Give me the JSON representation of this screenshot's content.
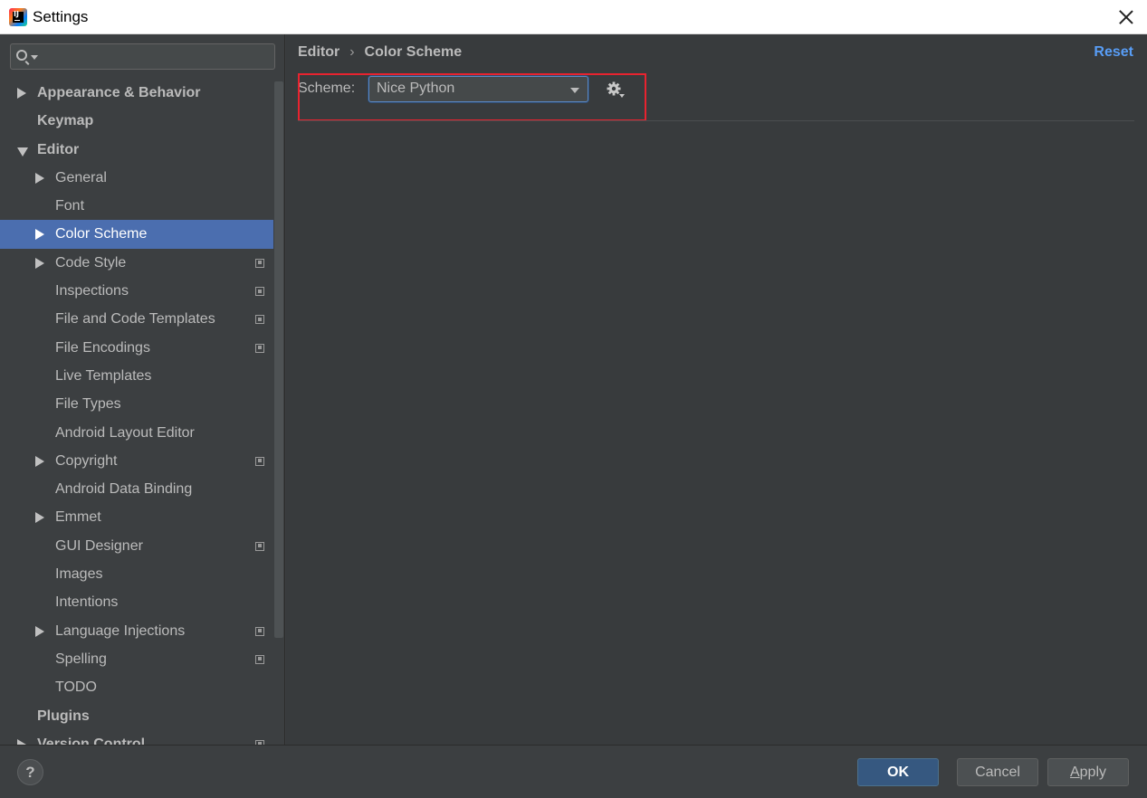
{
  "window": {
    "title": "Settings"
  },
  "search": {
    "placeholder": ""
  },
  "tree": {
    "items": [
      {
        "label": "Appearance & Behavior",
        "level": 0,
        "arrow": "right",
        "bold": true
      },
      {
        "label": "Keymap",
        "level": 0,
        "arrow": "none",
        "bold": true
      },
      {
        "label": "Editor",
        "level": 0,
        "arrow": "down",
        "bold": true
      },
      {
        "label": "General",
        "level": 1,
        "arrow": "right"
      },
      {
        "label": "Font",
        "level": 1,
        "arrow": "none"
      },
      {
        "label": "Color Scheme",
        "level": 1,
        "arrow": "right",
        "selected": true
      },
      {
        "label": "Code Style",
        "level": 1,
        "arrow": "right",
        "copy": true
      },
      {
        "label": "Inspections",
        "level": 1,
        "arrow": "none",
        "copy": true
      },
      {
        "label": "File and Code Templates",
        "level": 1,
        "arrow": "none",
        "copy": true
      },
      {
        "label": "File Encodings",
        "level": 1,
        "arrow": "none",
        "copy": true
      },
      {
        "label": "Live Templates",
        "level": 1,
        "arrow": "none"
      },
      {
        "label": "File Types",
        "level": 1,
        "arrow": "none"
      },
      {
        "label": "Android Layout Editor",
        "level": 1,
        "arrow": "none"
      },
      {
        "label": "Copyright",
        "level": 1,
        "arrow": "right",
        "copy": true
      },
      {
        "label": "Android Data Binding",
        "level": 1,
        "arrow": "none"
      },
      {
        "label": "Emmet",
        "level": 1,
        "arrow": "right"
      },
      {
        "label": "GUI Designer",
        "level": 1,
        "arrow": "none",
        "copy": true
      },
      {
        "label": "Images",
        "level": 1,
        "arrow": "none"
      },
      {
        "label": "Intentions",
        "level": 1,
        "arrow": "none"
      },
      {
        "label": "Language Injections",
        "level": 1,
        "arrow": "right",
        "copy": true
      },
      {
        "label": "Spelling",
        "level": 1,
        "arrow": "none",
        "copy": true
      },
      {
        "label": "TODO",
        "level": 1,
        "arrow": "none"
      },
      {
        "label": "Plugins",
        "level": 0,
        "arrow": "none",
        "bold": true
      },
      {
        "label": "Version Control",
        "level": 0,
        "arrow": "right",
        "bold": true,
        "copy": true
      }
    ]
  },
  "breadcrumb": {
    "parent": "Editor",
    "separator": "›",
    "current": "Color Scheme"
  },
  "header": {
    "reset_label": "Reset"
  },
  "scheme": {
    "label": "Scheme:",
    "selected": "Nice Python"
  },
  "icons": {
    "search": "search-icon",
    "dropdown": "chevron-down-icon",
    "gear": "gear-icon",
    "copy": "copy-icon",
    "help": "help-icon",
    "close": "close-icon"
  },
  "colors": {
    "selection": "#4b6eaf",
    "link": "#589df6",
    "highlight": "#e8232f",
    "ok_button": "#365880"
  },
  "footer": {
    "help_label": "?",
    "ok_label": "OK",
    "cancel_label": "Cancel",
    "apply_label_first": "A",
    "apply_label_rest": "pply"
  }
}
